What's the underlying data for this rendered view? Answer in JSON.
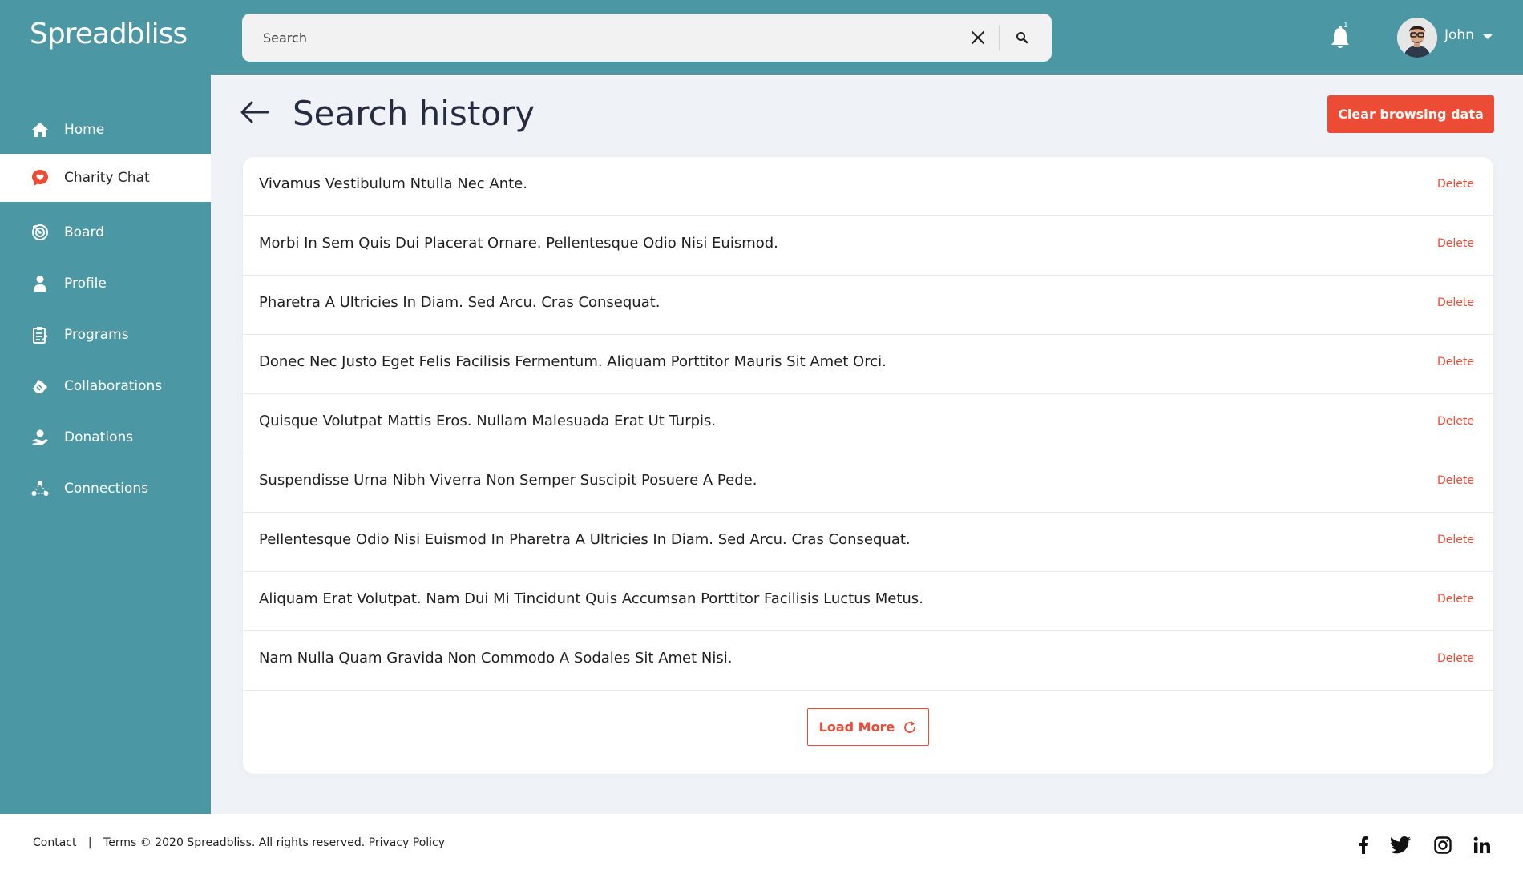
{
  "app": {
    "logo": "Spreadbliss"
  },
  "header": {
    "search_placeholder": "Search",
    "notification_count": "1",
    "user_name": "John"
  },
  "sidebar": {
    "items": [
      {
        "label": "Home",
        "icon": "home-icon",
        "active": false
      },
      {
        "label": "Charity Chat",
        "icon": "chat-heart-icon",
        "active": true
      },
      {
        "label": "Board",
        "icon": "target-icon",
        "active": false
      },
      {
        "label": "Profile",
        "icon": "user-icon",
        "active": false
      },
      {
        "label": "Programs",
        "icon": "clipboard-icon",
        "active": false
      },
      {
        "label": "Collaborations",
        "icon": "handshake-icon",
        "active": false
      },
      {
        "label": "Donations",
        "icon": "donation-icon",
        "active": false
      },
      {
        "label": "Connections",
        "icon": "network-icon",
        "active": false
      }
    ]
  },
  "main": {
    "title": "Search history",
    "clear_button": "Clear browsing data",
    "delete_label": "Delete",
    "history": [
      "Vivamus Vestibulum Ntulla Nec Ante.",
      "Morbi In Sem Quis Dui Placerat Ornare. Pellentesque Odio Nisi Euismod.",
      "Pharetra A Ultricies In Diam. Sed Arcu. Cras Consequat.",
      "Donec Nec Justo Eget Felis Facilisis Fermentum. Aliquam Porttitor Mauris Sit Amet Orci.",
      "Quisque Volutpat Mattis Eros. Nullam Malesuada Erat Ut Turpis.",
      "Suspendisse Urna Nibh Viverra Non Semper Suscipit Posuere A Pede.",
      "Pellentesque Odio Nisi Euismod In Pharetra A Ultricies In Diam. Sed Arcu. Cras Consequat.",
      "Aliquam Erat Volutpat. Nam Dui Mi Tincidunt Quis Accumsan Porttitor Facilisis Luctus Metus.",
      "Nam Nulla Quam Gravida Non Commodo A Sodales Sit Amet Nisi."
    ],
    "load_more": "Load More"
  },
  "footer": {
    "contact": "Contact",
    "separator": "|",
    "terms": "Terms",
    "copyright": "© 2020 Spreadbliss. All rights reserved.",
    "privacy": "Privacy Policy",
    "social": [
      "facebook-icon",
      "twitter-icon",
      "instagram-icon",
      "linkedin-icon"
    ]
  },
  "colors": {
    "primary": "#4b97a3",
    "accent": "#ec4b36",
    "background": "#eff3f7",
    "title": "#262b3f"
  }
}
